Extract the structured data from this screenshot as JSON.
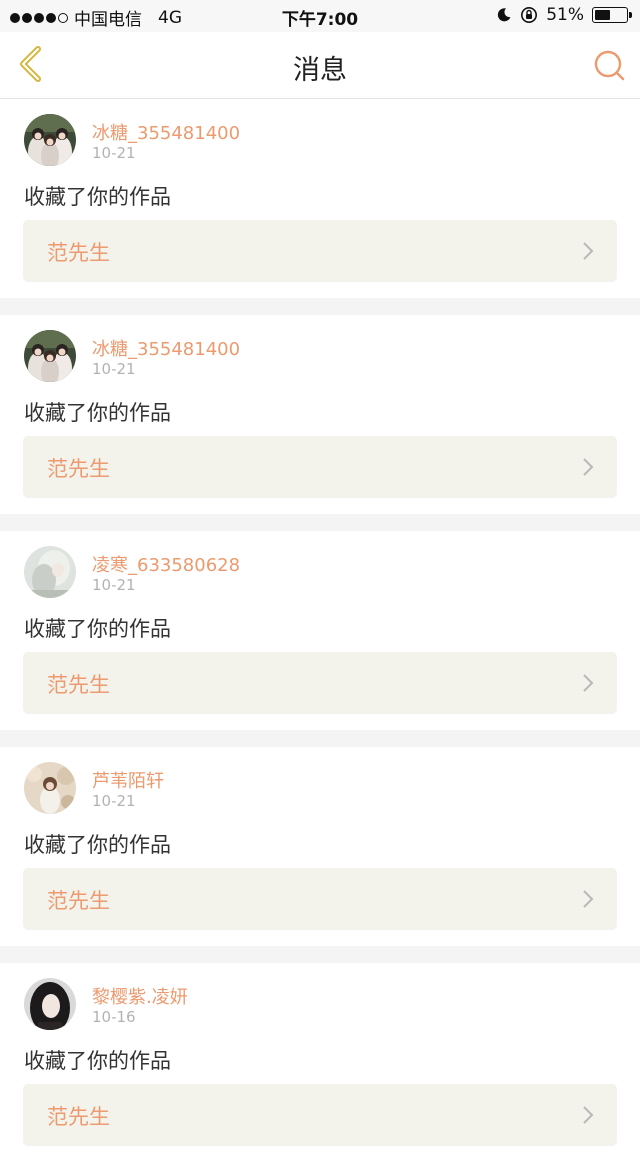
{
  "status_bar": {
    "carrier": "中国电信",
    "network": "4G",
    "time": "下午7:00",
    "battery": "51%",
    "battery_level": 0.51
  },
  "nav": {
    "title": "消息",
    "back_icon": "chevron-left-icon",
    "search_icon": "search-icon"
  },
  "colors": {
    "accent": "#ec9a6f",
    "back_icon": "#d9b43a",
    "card_bg": "#f3f3ec"
  },
  "messages": [
    {
      "username": "冰糖_355481400",
      "date": "10-21",
      "action": "收藏了你的作品",
      "work_title": "范先生"
    },
    {
      "username": "冰糖_355481400",
      "date": "10-21",
      "action": "收藏了你的作品",
      "work_title": "范先生"
    },
    {
      "username": "凌寒_633580628",
      "date": "10-21",
      "action": "收藏了你的作品",
      "work_title": "范先生"
    },
    {
      "username": "芦苇陌轩",
      "date": "10-21",
      "action": "收藏了你的作品",
      "work_title": "范先生"
    },
    {
      "username": "黎樱紫.凌妍",
      "date": "10-16",
      "action": "收藏了你的作品",
      "work_title": "范先生"
    }
  ]
}
